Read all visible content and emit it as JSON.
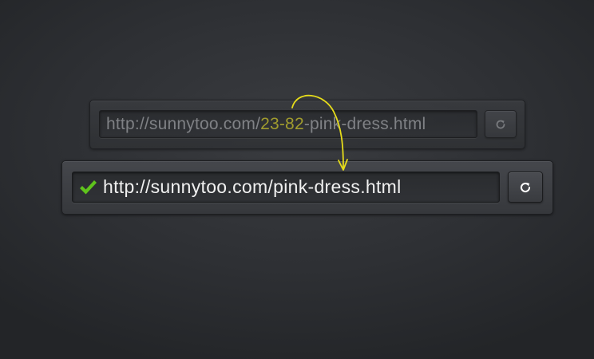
{
  "old_url": {
    "prefix": "http://sunnytoo.com/",
    "highlight": "23-82",
    "suffix": "-pink-dress.html"
  },
  "new_url": {
    "text": "http://sunnytoo.com/pink-dress.html"
  },
  "icons": {
    "status": "check-icon",
    "refresh": "refresh-icon"
  },
  "colors": {
    "highlight": "#b3ad2c",
    "arrow": "#e6dc1a",
    "check": "#5fc31c"
  }
}
